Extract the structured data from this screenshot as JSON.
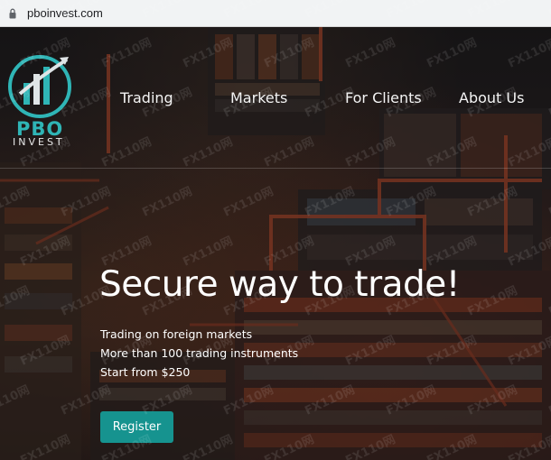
{
  "browser": {
    "url": "pboinvest.com"
  },
  "logo": {
    "name": "PBO",
    "subtitle": "INVEST"
  },
  "nav": {
    "items": [
      "Trading",
      "Markets",
      "For Clients",
      "About Us"
    ]
  },
  "hero": {
    "headline": "Secure way to trade!",
    "lines": [
      "Trading on foreign markets",
      "More than 100 trading instruments",
      "Start from $250"
    ],
    "cta_label": "Register"
  },
  "watermark": {
    "text": "FX110网"
  },
  "colors": {
    "accent": "#16938f",
    "logo_teal": "#2fb5b6",
    "text": "#ffffff"
  },
  "icons": {
    "lock": "lock-icon"
  }
}
